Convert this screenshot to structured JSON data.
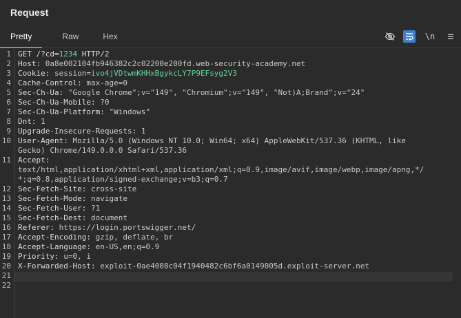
{
  "panel": {
    "title": "Request"
  },
  "tabs": [
    {
      "label": "Pretty"
    },
    {
      "label": "Raw"
    },
    {
      "label": "Hex"
    }
  ],
  "toolbar": {
    "hide_nonprint_icon": "eye-slash",
    "wrap_icon": "wrap-lines",
    "newline_label": "\\n",
    "menu_icon": "hamburger"
  },
  "colors": {
    "accent_tab": "#ff6633",
    "active_tool": "#3f7fcf",
    "param_value": "#65d49c"
  },
  "request": {
    "line1": {
      "method_path": "GET /?",
      "param_name": "cd",
      "eq": "=",
      "param_value": "1234",
      "rest": " HTTP/2"
    },
    "line2": {
      "key": "Host: ",
      "value": "0a8e002104fb946382c2c02200e200fd.web-security-academy.net"
    },
    "line3": {
      "key": "Cookie: ",
      "cookie_name": "session",
      "eq": "=",
      "cookie_value": "ivo4jVDtwmKHHxBgykcLY7P9EFsyg2V3"
    },
    "line4": {
      "key": "Cache-Control: ",
      "value": "max-age=0"
    },
    "line5": {
      "key": "Sec-Ch-Ua: ",
      "value": "\"Google Chrome\";v=\"149\", \"Chromium\";v=\"149\", \"Not)A;Brand\";v=\"24\""
    },
    "line6": {
      "key": "Sec-Ch-Ua-Mobile: ",
      "value": "?0"
    },
    "line7": {
      "key": "Sec-Ch-Ua-Platform: ",
      "value": "\"Windows\""
    },
    "line8": {
      "key": "Dnt: ",
      "value": "1"
    },
    "line9": {
      "key": "Upgrade-Insecure-Requests: ",
      "value": "1"
    },
    "line10a": {
      "key": "User-Agent: ",
      "value": "Mozilla/5.0 (Windows NT 10.0; Win64; x64) AppleWebKit/537.36 (KHTML, like"
    },
    "line10b": {
      "value": "Gecko) Chrome/149.0.0.0 Safari/537.36"
    },
    "line11": {
      "key": "Accept: "
    },
    "line11a": {
      "value": "text/html,application/xhtml+xml,application/xml;q=0.9,image/avif,image/webp,image/apng,*/"
    },
    "line11b": {
      "value": "*;q=0.8,application/signed-exchange;v=b3;q=0.7"
    },
    "line12": {
      "key": "Sec-Fetch-Site: ",
      "value": "cross-site"
    },
    "line13": {
      "key": "Sec-Fetch-Mode: ",
      "value": "navigate"
    },
    "line14": {
      "key": "Sec-Fetch-User: ",
      "value": "?1"
    },
    "line15": {
      "key": "Sec-Fetch-Dest: ",
      "value": "document"
    },
    "line16": {
      "key": "Referer: ",
      "value": "https://login.portswigger.net/"
    },
    "line17": {
      "key": "Accept-Encoding: ",
      "value": "gzip, deflate, br"
    },
    "line18": {
      "key": "Accept-Language: ",
      "value": "en-US,en;q=0.9"
    },
    "line19": {
      "key": "Priority: ",
      "value": "u=0, i"
    },
    "line20": {
      "key": "X-Forwarded-Host: ",
      "value": "exploit-0ae4008c04f1940482c6bf6a0149005d.exploit-server.net"
    }
  },
  "line_numbers": [
    "1",
    "2",
    "3",
    "4",
    "5",
    "6",
    "7",
    "8",
    "9",
    "10",
    "",
    "11",
    "",
    "",
    "12",
    "13",
    "14",
    "15",
    "16",
    "17",
    "18",
    "19",
    "20",
    "21",
    "22"
  ]
}
